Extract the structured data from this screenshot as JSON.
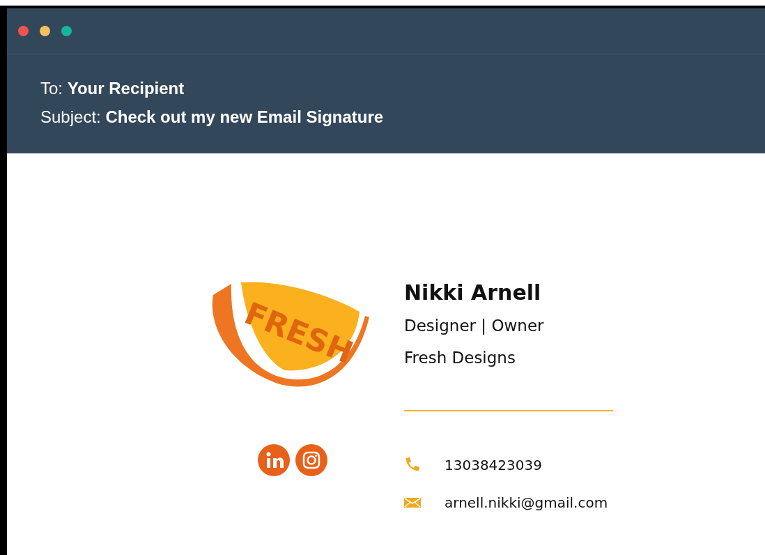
{
  "window": {
    "controls": [
      {
        "color": "#ef5350"
      },
      {
        "color": "#f5c062"
      },
      {
        "color": "#12b89a"
      }
    ]
  },
  "email": {
    "to": "To: **Your Recipient**",
    "subject": "Subject: **Check out my new Email Signature**"
  },
  "signature": {
    "logo_text": "FRESH",
    "name": "Nikki Arnell",
    "lines": [
      "Designer | Owner",
      "Fresh Designs"
    ],
    "social": [
      {
        "kind": "linkedin"
      },
      {
        "kind": "instagram"
      }
    ],
    "contacts": [
      {
        "kind": "phone",
        "text": "13038423039"
      },
      {
        "kind": "email",
        "text": "arnell.nikki@gmail.com"
      }
    ]
  }
}
